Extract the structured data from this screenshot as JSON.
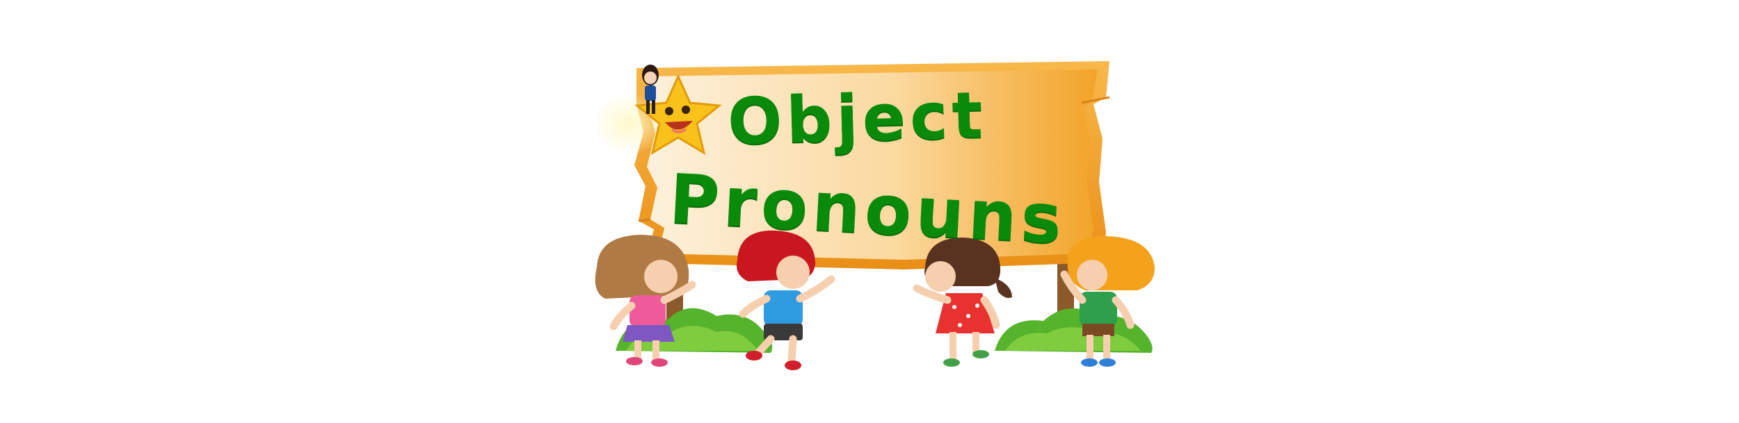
{
  "sign": {
    "title_line_1": "Object",
    "title_line_2": "Pronouns"
  },
  "colors": {
    "title_text": "#0a8a0a",
    "sign_light": "#fdf1dc",
    "sign_dark": "#f3a327",
    "star": "#f9c21a",
    "grass": "#56b32c"
  },
  "icons": {
    "star_mascot": "smiling-star-icon",
    "avatar": "girl-avatar-icon",
    "children": [
      "girl-pink-shirt",
      "boy-red-hair",
      "girl-red-dress",
      "boy-green-shirt"
    ]
  }
}
